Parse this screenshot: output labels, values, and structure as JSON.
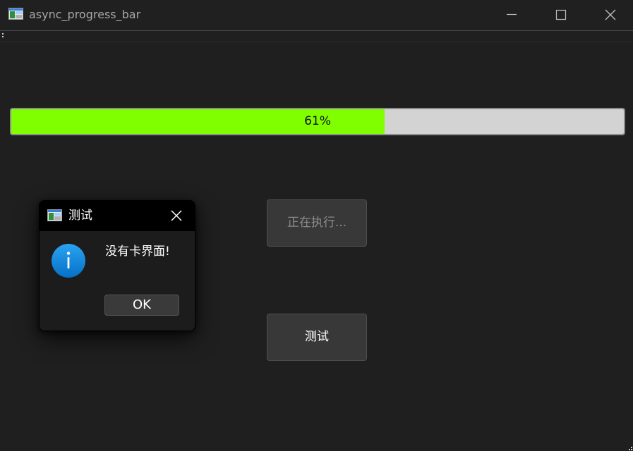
{
  "window": {
    "title": "async_progress_bar",
    "icon": "app-window-icon",
    "controls": {
      "minimize_icon": "minimize-icon",
      "maximize_icon": "maximize-icon",
      "close_icon": "close-icon"
    }
  },
  "progress": {
    "value": 0.61,
    "label": "61%",
    "fill_color": "#80ff00",
    "track_color": "#d3d3d3"
  },
  "buttons": {
    "running_label": "正在执行...",
    "test_label": "测试"
  },
  "dialog": {
    "title": "测试",
    "icon": "app-window-icon",
    "message": "没有卡界面!",
    "info_icon": "info-icon",
    "info_color": "#0a84d8",
    "ok_label": "OK",
    "close_icon": "close-icon"
  },
  "colors": {
    "background": "#1f1f1f",
    "button_bg": "#383838",
    "dialog_titlebar": "#000000"
  }
}
